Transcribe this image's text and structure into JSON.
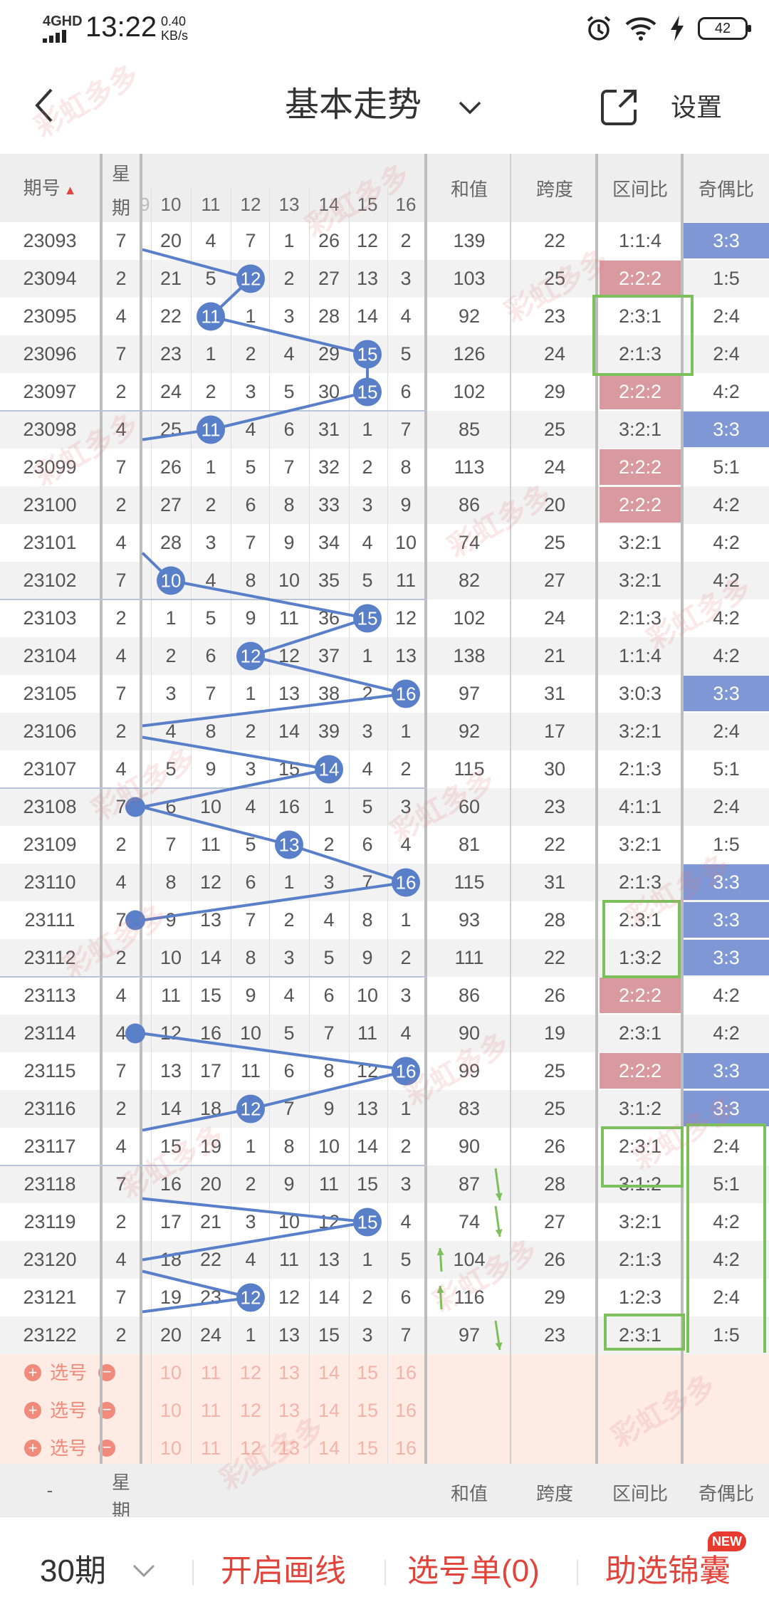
{
  "status_bar": {
    "network": "4GHD",
    "time": "13:22",
    "speed_value": "0.40",
    "speed_unit": "KB/s",
    "battery": "42"
  },
  "nav": {
    "title": "基本走势",
    "settings": "设置"
  },
  "table": {
    "headers": {
      "issue": "期号",
      "week_top": "星",
      "week_bottom": "期",
      "sum": "和值",
      "span": "跨度",
      "zone_ratio": "区间比",
      "odd_even": "奇偶比"
    },
    "number_columns": [
      "10",
      "11",
      "12",
      "13",
      "14",
      "15",
      "16"
    ],
    "rows": [
      {
        "issue": "23093",
        "week": "7",
        "nums": [
          "20",
          "4",
          "7",
          "1",
          "26",
          "12",
          "2"
        ],
        "sum": "139",
        "span": "22",
        "zone": "1:1:4",
        "oe": "3:3"
      },
      {
        "issue": "23094",
        "week": "2",
        "nums": [
          "21",
          "5",
          "12",
          "2",
          "27",
          "13",
          "3"
        ],
        "sum": "103",
        "span": "25",
        "zone": "2:2:2",
        "oe": "1:5"
      },
      {
        "issue": "23095",
        "week": "4",
        "nums": [
          "22",
          "11",
          "1",
          "3",
          "28",
          "14",
          "4"
        ],
        "sum": "92",
        "span": "23",
        "zone": "2:3:1",
        "oe": "2:4"
      },
      {
        "issue": "23096",
        "week": "7",
        "nums": [
          "23",
          "1",
          "2",
          "4",
          "29",
          "15",
          "5"
        ],
        "sum": "126",
        "span": "24",
        "zone": "2:1:3",
        "oe": "2:4"
      },
      {
        "issue": "23097",
        "week": "2",
        "nums": [
          "24",
          "2",
          "3",
          "5",
          "30",
          "15",
          "6"
        ],
        "sum": "102",
        "span": "29",
        "zone": "2:2:2",
        "oe": "4:2"
      },
      {
        "issue": "23098",
        "week": "4",
        "nums": [
          "25",
          "11",
          "4",
          "6",
          "31",
          "1",
          "7"
        ],
        "sum": "85",
        "span": "25",
        "zone": "3:2:1",
        "oe": "3:3"
      },
      {
        "issue": "23099",
        "week": "7",
        "nums": [
          "26",
          "1",
          "5",
          "7",
          "32",
          "2",
          "8"
        ],
        "sum": "113",
        "span": "24",
        "zone": "2:2:2",
        "oe": "5:1"
      },
      {
        "issue": "23100",
        "week": "2",
        "nums": [
          "27",
          "2",
          "6",
          "8",
          "33",
          "3",
          "9"
        ],
        "sum": "86",
        "span": "20",
        "zone": "2:2:2",
        "oe": "4:2"
      },
      {
        "issue": "23101",
        "week": "4",
        "nums": [
          "28",
          "3",
          "7",
          "9",
          "34",
          "4",
          "10"
        ],
        "sum": "74",
        "span": "25",
        "zone": "3:2:1",
        "oe": "4:2"
      },
      {
        "issue": "23102",
        "week": "7",
        "nums": [
          "10",
          "4",
          "8",
          "10",
          "35",
          "5",
          "11"
        ],
        "sum": "82",
        "span": "27",
        "zone": "3:2:1",
        "oe": "4:2"
      },
      {
        "issue": "23103",
        "week": "2",
        "nums": [
          "1",
          "5",
          "9",
          "11",
          "36",
          "15",
          "12"
        ],
        "sum": "102",
        "span": "24",
        "zone": "2:1:3",
        "oe": "4:2"
      },
      {
        "issue": "23104",
        "week": "4",
        "nums": [
          "2",
          "6",
          "12",
          "12",
          "37",
          "1",
          "13"
        ],
        "sum": "138",
        "span": "21",
        "zone": "1:1:4",
        "oe": "4:2"
      },
      {
        "issue": "23105",
        "week": "7",
        "nums": [
          "3",
          "7",
          "1",
          "13",
          "38",
          "2",
          "16"
        ],
        "sum": "97",
        "span": "31",
        "zone": "3:0:3",
        "oe": "3:3"
      },
      {
        "issue": "23106",
        "week": "2",
        "nums": [
          "4",
          "8",
          "2",
          "14",
          "39",
          "3",
          "1"
        ],
        "sum": "92",
        "span": "17",
        "zone": "3:2:1",
        "oe": "2:4"
      },
      {
        "issue": "23107",
        "week": "4",
        "nums": [
          "5",
          "9",
          "3",
          "15",
          "14",
          "4",
          "2"
        ],
        "sum": "115",
        "span": "30",
        "zone": "2:1:3",
        "oe": "5:1"
      },
      {
        "issue": "23108",
        "week": "7",
        "nums": [
          "6",
          "10",
          "4",
          "16",
          "1",
          "5",
          "3"
        ],
        "sum": "60",
        "span": "23",
        "zone": "4:1:1",
        "oe": "2:4"
      },
      {
        "issue": "23109",
        "week": "2",
        "nums": [
          "7",
          "11",
          "5",
          "13",
          "2",
          "6",
          "4"
        ],
        "sum": "81",
        "span": "22",
        "zone": "3:2:1",
        "oe": "1:5"
      },
      {
        "issue": "23110",
        "week": "4",
        "nums": [
          "8",
          "12",
          "6",
          "1",
          "3",
          "7",
          "16"
        ],
        "sum": "115",
        "span": "31",
        "zone": "2:1:3",
        "oe": "3:3"
      },
      {
        "issue": "23111",
        "week": "7",
        "nums": [
          "9",
          "13",
          "7",
          "2",
          "4",
          "8",
          "1"
        ],
        "sum": "93",
        "span": "28",
        "zone": "2:3:1",
        "oe": "3:3"
      },
      {
        "issue": "23112",
        "week": "2",
        "nums": [
          "10",
          "14",
          "8",
          "3",
          "5",
          "9",
          "2"
        ],
        "sum": "111",
        "span": "22",
        "zone": "1:3:2",
        "oe": "3:3"
      },
      {
        "issue": "23113",
        "week": "4",
        "nums": [
          "11",
          "15",
          "9",
          "4",
          "6",
          "10",
          "3"
        ],
        "sum": "86",
        "span": "26",
        "zone": "2:2:2",
        "oe": "4:2"
      },
      {
        "issue": "23114",
        "week": "4",
        "nums": [
          "12",
          "16",
          "10",
          "5",
          "7",
          "11",
          "4"
        ],
        "sum": "90",
        "span": "19",
        "zone": "2:3:1",
        "oe": "4:2"
      },
      {
        "issue": "23115",
        "week": "7",
        "nums": [
          "13",
          "17",
          "11",
          "6",
          "8",
          "12",
          "16"
        ],
        "sum": "99",
        "span": "25",
        "zone": "2:2:2",
        "oe": "3:3"
      },
      {
        "issue": "23116",
        "week": "2",
        "nums": [
          "14",
          "18",
          "12",
          "7",
          "9",
          "13",
          "1"
        ],
        "sum": "83",
        "span": "25",
        "zone": "3:1:2",
        "oe": "3:3"
      },
      {
        "issue": "23117",
        "week": "4",
        "nums": [
          "15",
          "19",
          "1",
          "8",
          "10",
          "14",
          "2"
        ],
        "sum": "90",
        "span": "26",
        "zone": "2:3:1",
        "oe": "2:4"
      },
      {
        "issue": "23118",
        "week": "7",
        "nums": [
          "16",
          "20",
          "2",
          "9",
          "11",
          "15",
          "3"
        ],
        "sum": "87",
        "span": "28",
        "zone": "3:1:2",
        "oe": "5:1"
      },
      {
        "issue": "23119",
        "week": "2",
        "nums": [
          "17",
          "21",
          "3",
          "10",
          "12",
          "15",
          "4"
        ],
        "sum": "74",
        "span": "27",
        "zone": "3:2:1",
        "oe": "4:2"
      },
      {
        "issue": "23120",
        "week": "4",
        "nums": [
          "18",
          "22",
          "4",
          "11",
          "13",
          "1",
          "5"
        ],
        "sum": "104",
        "span": "26",
        "zone": "2:1:3",
        "oe": "4:2"
      },
      {
        "issue": "23121",
        "week": "7",
        "nums": [
          "19",
          "23",
          "12",
          "12",
          "14",
          "2",
          "6"
        ],
        "sum": "116",
        "span": "29",
        "zone": "1:2:3",
        "oe": "2:4"
      },
      {
        "issue": "23122",
        "week": "2",
        "nums": [
          "20",
          "24",
          "1",
          "13",
          "15",
          "3",
          "7"
        ],
        "sum": "97",
        "span": "23",
        "zone": "2:3:1",
        "oe": "1:5"
      }
    ],
    "select_label": "选号",
    "select_numbers": [
      "10",
      "11",
      "12",
      "13",
      "14",
      "15",
      "16"
    ]
  },
  "bottom_bar": {
    "period": "30期",
    "draw_lines": "开启画线",
    "selection_list": "选号单(0)",
    "helper": "助选锦囊",
    "new_badge": "NEW"
  },
  "footer_header": {
    "issue": "-",
    "week_top": "星",
    "week_bottom": "期",
    "sum": "和值",
    "span": "跨度",
    "zone_ratio": "区间比",
    "odd_even": "奇偶比"
  },
  "watermark": "彩虹多多",
  "colors": {
    "ball": "#5a7fc9",
    "line": "#5a7fc9",
    "red_cell": "#d89a9e",
    "blue_cell": "#7f97d5",
    "green_box": "#7cc05c",
    "action_red": "#e0443b",
    "select_bg": "#fdebe4"
  }
}
